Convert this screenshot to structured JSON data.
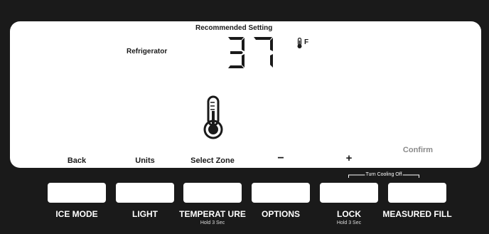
{
  "display": {
    "recommended": "Recommended Setting",
    "zone": "Refrigerator",
    "temperature": "37",
    "unit": "F"
  },
  "soft_keys": {
    "back": "Back",
    "units": "Units",
    "select_zone": "Select Zone",
    "minus": "−",
    "plus": "+",
    "confirm": "Confirm"
  },
  "cooling_off": "Turn Cooling Off",
  "buttons": [
    {
      "label": "ICE MODE",
      "sub": ""
    },
    {
      "label": "LIGHT",
      "sub": ""
    },
    {
      "label": "TEMPERAT URE",
      "sub": "Hold 3 Sec"
    },
    {
      "label": "OPTIONS",
      "sub": ""
    },
    {
      "label": "LOCK",
      "sub": "Hold 3 Sec"
    },
    {
      "label": "MEASURED FILL",
      "sub": ""
    }
  ],
  "colors": {
    "panel": "#1a1a1a",
    "display": "#ffffff",
    "confirm_dim": "#8a8a8a"
  },
  "icons": [
    "thermometer-icon",
    "thermometer-small-icon"
  ]
}
